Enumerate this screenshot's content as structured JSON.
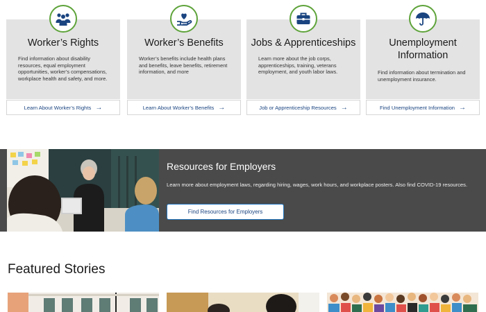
{
  "cards": [
    {
      "icon": "people-group-icon",
      "title": "Worker’s Rights",
      "description": "Find information about disability resources, equal employment opportunities, worker’s compensations, workplace health and safety, and more.",
      "link": "Learn About Worker’s Rights"
    },
    {
      "icon": "hand-heart-icon",
      "title": "Worker’s Benefits",
      "description": "Worker’s benefits include health plans and benefits, leave benefits, retirement information, and more",
      "link": "Learn About Worker’s Benefits"
    },
    {
      "icon": "briefcase-icon",
      "title": "Jobs & Apprenticeships",
      "description": "Learn more about the job corps, apprenticeships, training, veterans employment, and youth labor laws.",
      "link": "Job or Apprenticeship Resources"
    },
    {
      "icon": "umbrella-icon",
      "title": "Unemployment Information",
      "description": "Find information about termination and unemployment insurance.",
      "link": "Find Unemployment Information"
    }
  ],
  "employers": {
    "title": "Resources for Employers",
    "description": "Learn more about employment laws, regarding hiring, wages, work hours, and workplace posters. Also find COVID-19 resources.",
    "button": "Find Resources for Employers"
  },
  "featured": {
    "title": "Featured Stories"
  },
  "colors": {
    "accent_green": "#5ea33a",
    "icon_blue": "#1a4480",
    "link_blue": "#1a4480",
    "card_bg": "#e3e3e3",
    "banner_bg": "#4a4a4a"
  }
}
